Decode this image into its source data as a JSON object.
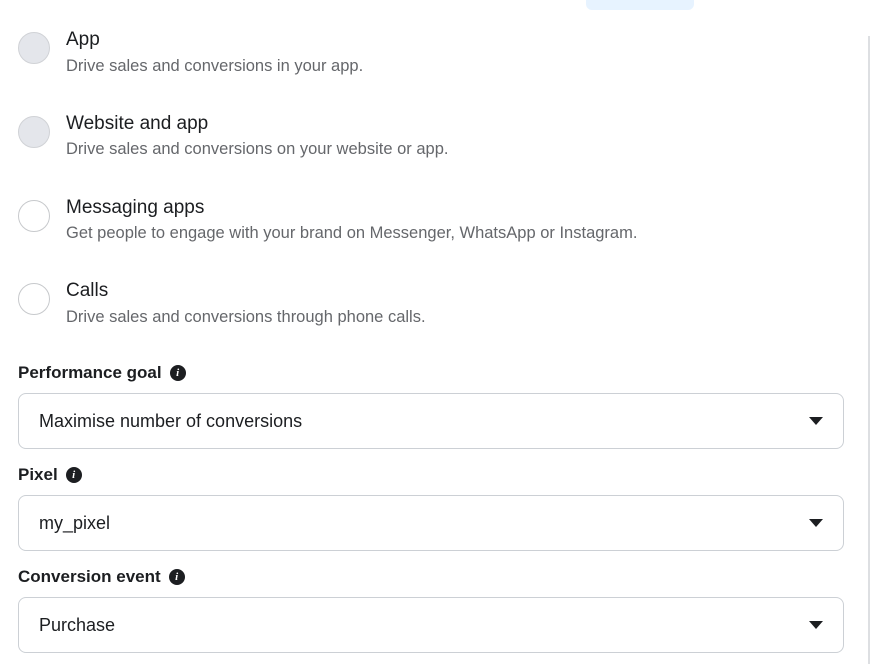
{
  "options": [
    {
      "title": "App",
      "desc": "Drive sales and conversions in your app.",
      "shaded": true
    },
    {
      "title": "Website and app",
      "desc": "Drive sales and conversions on your website or app.",
      "shaded": true
    },
    {
      "title": "Messaging apps",
      "desc": "Get people to engage with your brand on Messenger, WhatsApp or Instagram.",
      "shaded": false
    },
    {
      "title": "Calls",
      "desc": "Drive sales and conversions through phone calls.",
      "shaded": false
    }
  ],
  "fields": {
    "performance_goal": {
      "label": "Performance goal",
      "value": "Maximise number of conversions"
    },
    "pixel": {
      "label": "Pixel",
      "value": "my_pixel"
    },
    "conversion_event": {
      "label": "Conversion event",
      "value": "Purchase"
    }
  }
}
